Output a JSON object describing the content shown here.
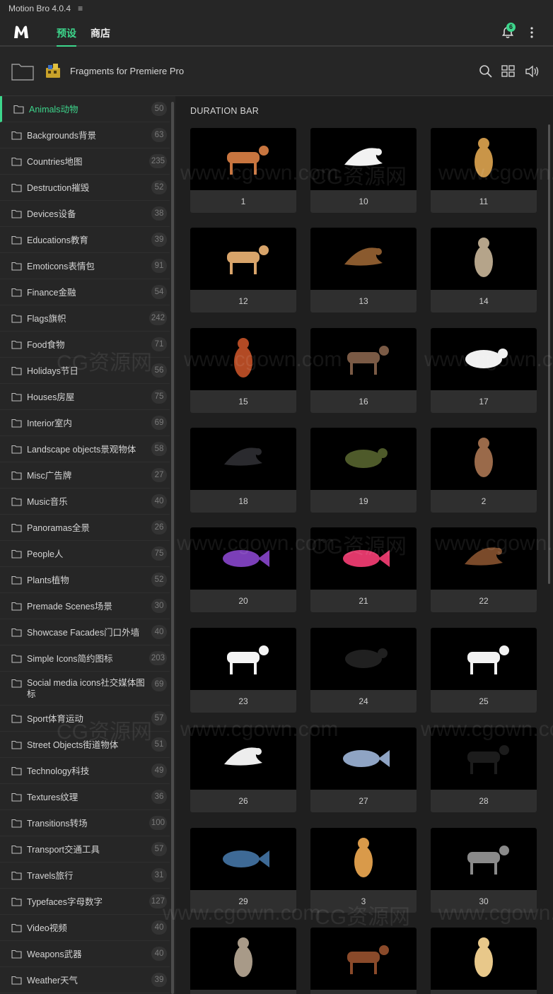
{
  "app": {
    "title": "Motion Bro 4.0.4",
    "menu_glyph": "≡"
  },
  "nav": {
    "tabs": [
      {
        "label": "预设",
        "active": true
      },
      {
        "label": "商店",
        "active": false
      }
    ],
    "notification_count": "6",
    "accent": "#3dd68c"
  },
  "path": {
    "pack_title": "Fragments for Premiere Pro"
  },
  "sidebar": {
    "categories": [
      {
        "label": "Animals动物",
        "count": "50",
        "active": true
      },
      {
        "label": "Backgrounds背景",
        "count": "63"
      },
      {
        "label": "Countries地图",
        "count": "235"
      },
      {
        "label": "Destruction摧毁",
        "count": "52"
      },
      {
        "label": "Devices设备",
        "count": "38"
      },
      {
        "label": "Educations教育",
        "count": "39"
      },
      {
        "label": "Emoticons表情包",
        "count": "91"
      },
      {
        "label": "Finance金融",
        "count": "54"
      },
      {
        "label": "Flags旗帜",
        "count": "242"
      },
      {
        "label": "Food食物",
        "count": "71"
      },
      {
        "label": "Holidays节日",
        "count": "56"
      },
      {
        "label": "Houses房屋",
        "count": "75"
      },
      {
        "label": "Interior室内",
        "count": "69"
      },
      {
        "label": "Landscape objects景观物体",
        "count": "58"
      },
      {
        "label": "Misc广告牌",
        "count": "27"
      },
      {
        "label": "Music音乐",
        "count": "40"
      },
      {
        "label": "Panoramas全景",
        "count": "26"
      },
      {
        "label": "People人",
        "count": "75"
      },
      {
        "label": "Plants植物",
        "count": "52"
      },
      {
        "label": "Premade Scenes场景",
        "count": "30"
      },
      {
        "label": "Showcase Facades门口外墙",
        "count": "40"
      },
      {
        "label": "Simple Icons简约图标",
        "count": "203"
      },
      {
        "label": "Social media icons社交媒体图标",
        "count": "69"
      },
      {
        "label": "Sport体育运动",
        "count": "57"
      },
      {
        "label": "Street Objects街道物体",
        "count": "51"
      },
      {
        "label": "Technology科技",
        "count": "49"
      },
      {
        "label": "Textures纹理",
        "count": "36"
      },
      {
        "label": "Transitions转场",
        "count": "100"
      },
      {
        "label": "Transport交通工具",
        "count": "57"
      },
      {
        "label": "Travels旅行",
        "count": "31"
      },
      {
        "label": "Typefaces字母数字",
        "count": "127"
      },
      {
        "label": "Video视频",
        "count": "40"
      },
      {
        "label": "Weapons武器",
        "count": "40"
      },
      {
        "label": "Weather天气",
        "count": "39"
      }
    ]
  },
  "content": {
    "section_title": "DURATION BAR",
    "items": [
      {
        "label": "1",
        "icon": "cat-icon",
        "color": "#c8753f"
      },
      {
        "label": "10",
        "icon": "dove-icon",
        "color": "#f2f2f2"
      },
      {
        "label": "11",
        "icon": "owl-icon",
        "color": "#c99548"
      },
      {
        "label": "12",
        "icon": "camel-icon",
        "color": "#d8a46a"
      },
      {
        "label": "13",
        "icon": "sparrow-icon",
        "color": "#8a5a2e"
      },
      {
        "label": "14",
        "icon": "monkey-icon",
        "color": "#b5a48a"
      },
      {
        "label": "15",
        "icon": "bear-icon",
        "color": "#b24a24"
      },
      {
        "label": "16",
        "icon": "dinosaur-icon",
        "color": "#7a5a45"
      },
      {
        "label": "17",
        "icon": "hen-icon",
        "color": "#f0f0f0"
      },
      {
        "label": "18",
        "icon": "crow-icon",
        "color": "#2a2a2e"
      },
      {
        "label": "19",
        "icon": "crocodile-icon",
        "color": "#4e5a2a"
      },
      {
        "label": "2",
        "icon": "rabbit-icon",
        "color": "#9a6a4a"
      },
      {
        "label": "20",
        "icon": "fish-icon",
        "color": "#7b3fb8"
      },
      {
        "label": "21",
        "icon": "betta-fish-icon",
        "color": "#e0386a"
      },
      {
        "label": "22",
        "icon": "hawk-icon",
        "color": "#7a4a2a"
      },
      {
        "label": "23",
        "icon": "zebra-icon",
        "color": "#f4f4f4"
      },
      {
        "label": "24",
        "icon": "raven-icon",
        "color": "#202020"
      },
      {
        "label": "25",
        "icon": "cow-icon",
        "color": "#f2f2f2"
      },
      {
        "label": "26",
        "icon": "seagull-icon",
        "color": "#ededed"
      },
      {
        "label": "27",
        "icon": "shark-icon",
        "color": "#8fa4c4"
      },
      {
        "label": "28",
        "icon": "bull-icon",
        "color": "#1c1c1c"
      },
      {
        "label": "29",
        "icon": "whale-icon",
        "color": "#3e6a96"
      },
      {
        "label": "3",
        "icon": "giraffe-icon",
        "color": "#d99a4a"
      },
      {
        "label": "30",
        "icon": "wolf-icon",
        "color": "#8a8a8a"
      },
      {
        "label": "",
        "icon": "tabby-cat-icon",
        "color": "#a89a88"
      },
      {
        "label": "",
        "icon": "horse-icon",
        "color": "#8a4a2a"
      },
      {
        "label": "",
        "icon": "dog-icon",
        "color": "#e8c88a"
      }
    ]
  },
  "watermark": {
    "text1": "www.cgown.com",
    "text2": "CG资源网"
  }
}
